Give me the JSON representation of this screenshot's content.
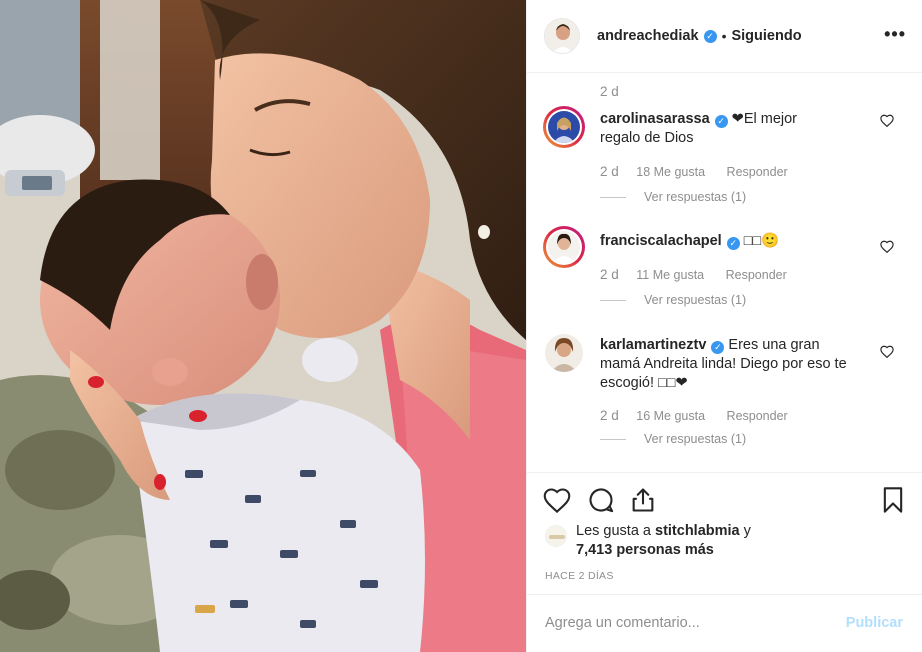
{
  "post": {
    "username": "andreachediak",
    "verified_mark": "✓",
    "dot": "•",
    "follow_status": "Siguiendo",
    "more_icon": "more-horizontal-icon",
    "more_label": "•••"
  },
  "comments": {
    "caption_time": "2 d",
    "items": [
      {
        "username": "carolinasarassa",
        "text": "❤El mejor regalo de Dios",
        "time": "2 d",
        "likes": "18 Me gusta",
        "reply": "Responder",
        "view_replies": "Ver respuestas (1)",
        "story_ring": true
      },
      {
        "username": "franciscalachapel",
        "text": "□□🙂",
        "time": "2 d",
        "likes": "11 Me gusta",
        "reply": "Responder",
        "view_replies": "Ver respuestas (1)",
        "story_ring": true
      },
      {
        "username": "karlamartineztv",
        "text": "Eres una gran mamá Andreita linda! Diego por eso te escogió! □□❤",
        "time": "2 d",
        "likes": "16 Me gusta",
        "reply": "Responder",
        "view_replies": "Ver respuestas (1)",
        "story_ring": false
      }
    ]
  },
  "actions": {
    "icons": [
      "heart-icon",
      "comment-icon",
      "share-icon",
      "bookmark-icon"
    ],
    "liked_by_prefix": "Les gusta a",
    "liked_by_user": "stitchlabmia",
    "liked_by_suffix": "y",
    "others": "7,413 personas más",
    "posted_ago": "HACE 2 DÍAS"
  },
  "add_comment": {
    "placeholder": "Agrega un comentario...",
    "publish_label": "Publicar"
  },
  "colors": {
    "verified": "#3897f0",
    "secondary_text": "#8e8e8e",
    "publish_disabled": "#b2dffc",
    "heart_red": "#ed4956"
  }
}
